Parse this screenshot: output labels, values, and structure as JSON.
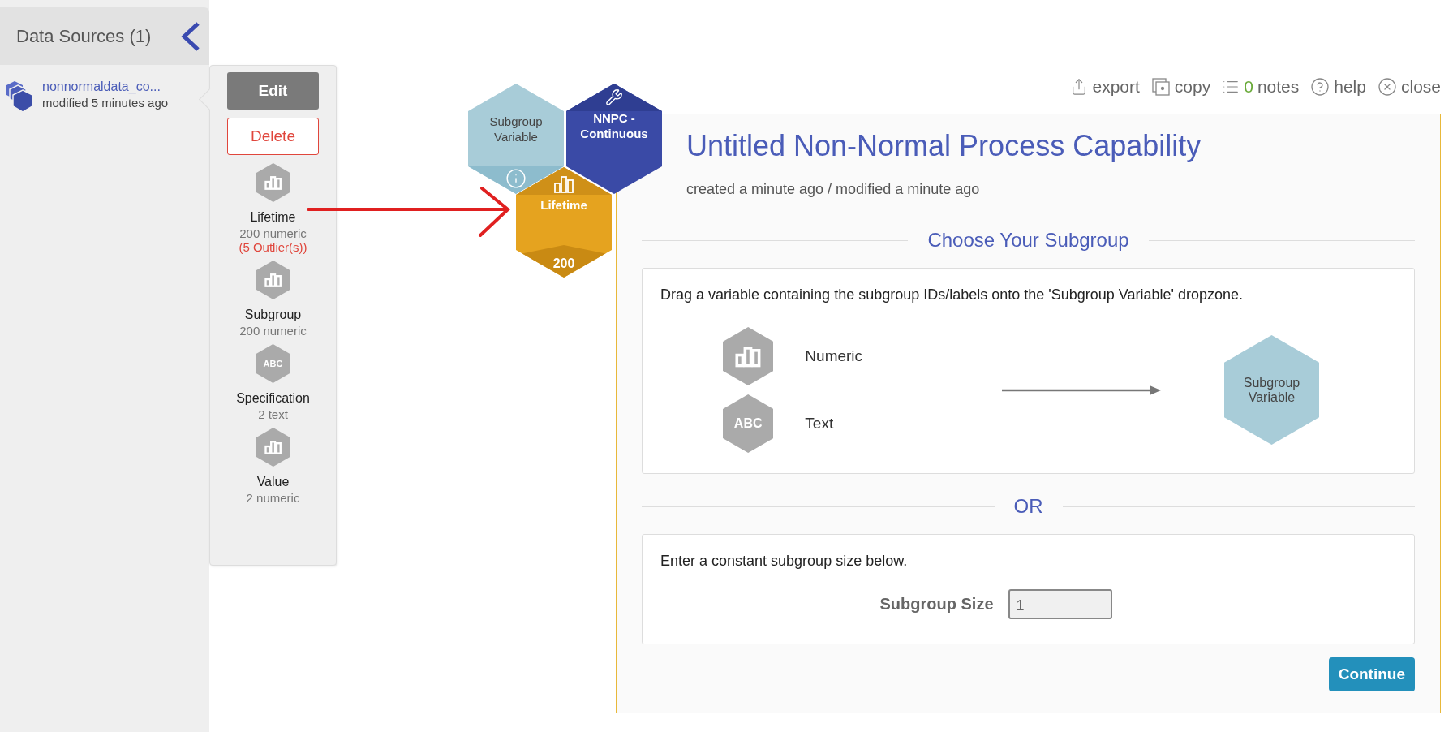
{
  "sidebar": {
    "title": "Data Sources (1)",
    "sources": [
      {
        "name": "nonnormaldata_co...",
        "modified": "modified 5 minutes ago"
      }
    ]
  },
  "popover": {
    "buttons": [
      {
        "label": "Edit",
        "kind": "primary"
      },
      {
        "label": "Delete",
        "kind": "danger"
      }
    ],
    "variables": [
      {
        "name": "Lifetime",
        "kind": "numeric",
        "summary": "200 numeric",
        "outliers": "(5 Outlier(s))"
      },
      {
        "name": "Subgroup",
        "kind": "numeric",
        "summary": "200 numeric"
      },
      {
        "name": "Specification",
        "kind": "text",
        "badge": "ABC",
        "summary": "2 text"
      },
      {
        "name": "Value",
        "kind": "numeric",
        "summary": "2 numeric"
      }
    ]
  },
  "canvas": {
    "dropzone": {
      "label": "Subgroup Variable"
    },
    "tool": {
      "label": "NNPC - Continuous"
    },
    "assigned": {
      "name": "Lifetime",
      "count": "200"
    }
  },
  "toolbar": [
    {
      "kind": "export",
      "label": "export"
    },
    {
      "kind": "copy",
      "label": "copy"
    },
    {
      "kind": "notes",
      "count": "0",
      "label": "notes"
    },
    {
      "kind": "help",
      "label": "help"
    },
    {
      "kind": "close",
      "label": "close"
    }
  ],
  "card": {
    "title": "Untitled Non-Normal Process Capability",
    "meta": "created a minute ago / modified a minute ago",
    "section": "Choose Your Subgroup",
    "instructions": "Drag a variable containing the subgroup IDs/labels onto the 'Subgroup Variable' dropzone.",
    "types": [
      {
        "kind": "numeric",
        "label": "Numeric"
      },
      {
        "kind": "text",
        "badge": "ABC",
        "label": "Text"
      }
    ],
    "target": "Subgroup Variable",
    "or": "OR",
    "constant_instructions": "Enter a constant subgroup size below.",
    "size_label": "Subgroup Size",
    "size_value": "1",
    "continue": "Continue"
  }
}
